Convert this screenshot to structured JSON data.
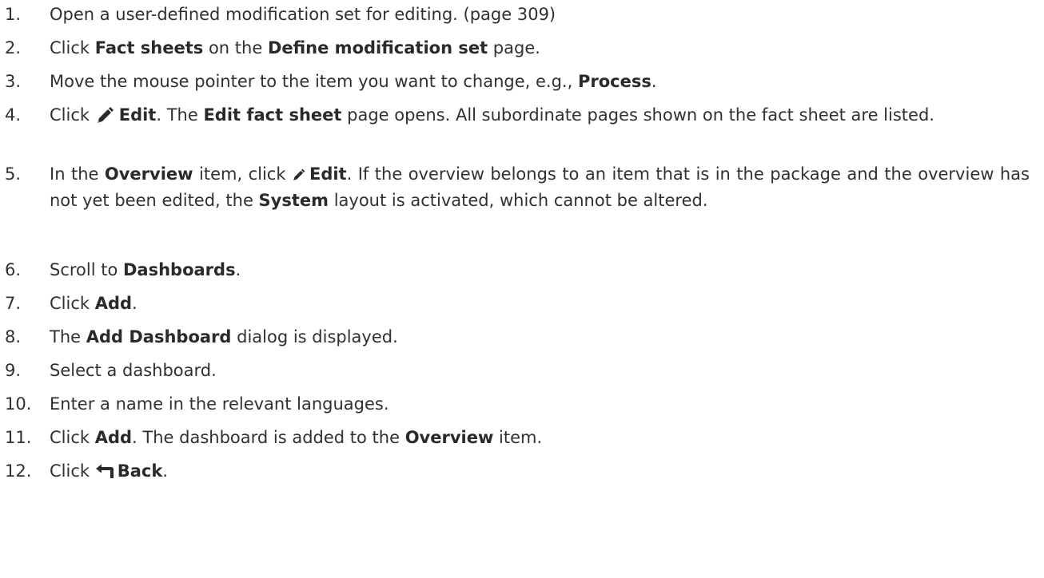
{
  "steps": [
    {
      "num": "1.",
      "parts": [
        "Open a user-defined modification set for editing. (page 309)"
      ]
    },
    {
      "num": "2.",
      "parts": [
        "Click ",
        "Fact sheets",
        " on the ",
        "Define modification set",
        " page."
      ]
    },
    {
      "num": "3.",
      "parts": [
        "Move the mouse pointer to the item you want to change, e.g., ",
        "Process",
        "."
      ]
    },
    {
      "num": "4.",
      "icon": "pencil-icon",
      "parts": [
        "Click ",
        "Edit",
        ". The ",
        "Edit fact sheet",
        " page opens. All subordinate pages shown on the fact sheet are listed."
      ]
    },
    {
      "num": "5.",
      "icon": "pencil-icon",
      "parts": [
        "In the ",
        "Overview",
        " item, click ",
        "Edit",
        ". If the overview belongs to an item that is in the package and the overview has not yet been edited, the ",
        "System",
        " layout is activated, which cannot be altered."
      ]
    },
    {
      "num": "6.",
      "parts": [
        "Scroll to ",
        "Dashboards",
        "."
      ]
    },
    {
      "num": "7.",
      "parts": [
        "Click ",
        "Add",
        "."
      ]
    },
    {
      "num": "8.",
      "parts": [
        "The ",
        "Add Dashboard",
        " dialog is displayed."
      ]
    },
    {
      "num": "9.",
      "parts": [
        "Select a dashboard."
      ]
    },
    {
      "num": "10.",
      "parts": [
        "Enter a name in the relevant languages."
      ]
    },
    {
      "num": "11.",
      "parts": [
        "Click ",
        "Add",
        ". The dashboard is added to the ",
        "Overview",
        " item."
      ]
    },
    {
      "num": "12.",
      "icon": "back-arrow-icon",
      "parts": [
        "Click ",
        "Back",
        "."
      ]
    }
  ]
}
